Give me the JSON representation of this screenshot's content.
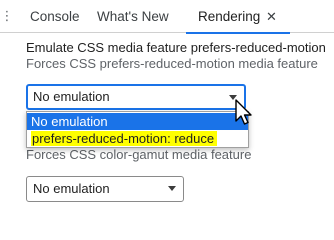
{
  "tabs": {
    "console": "Console",
    "whats_new": "What's New",
    "rendering": "Rendering",
    "close": "✕"
  },
  "reduced_motion": {
    "title": "Emulate CSS media feature prefers-reduced-motion",
    "description": "Forces CSS prefers-reduced-motion media feature",
    "selected": "No emulation",
    "options": [
      "No emulation",
      "prefers-reduced-motion: reduce"
    ]
  },
  "color_gamut": {
    "title_fragment": "ut",
    "description": "Forces CSS color-gamut media feature",
    "selected": "No emulation"
  },
  "colors": {
    "accent": "#1a73e8",
    "highlight": "#ffff00"
  }
}
